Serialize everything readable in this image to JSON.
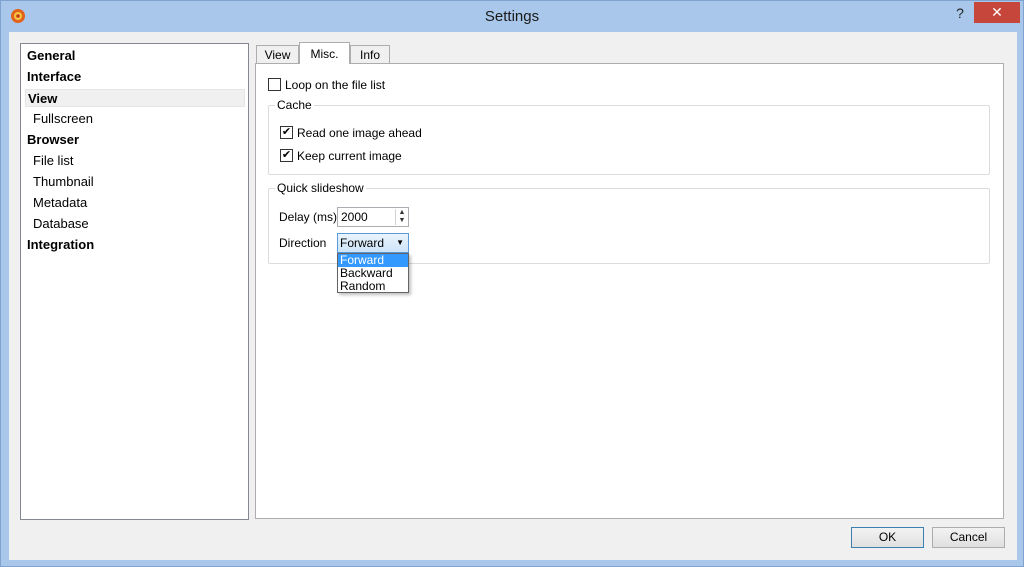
{
  "window": {
    "title": "Settings",
    "help_label": "?",
    "close_label": "✕"
  },
  "nav": {
    "items": [
      {
        "label": "General",
        "level": 0
      },
      {
        "label": "Interface",
        "level": 0
      },
      {
        "label": "View",
        "level": 0,
        "selected": true
      },
      {
        "label": "Fullscreen",
        "level": 1
      },
      {
        "label": "Browser",
        "level": 0
      },
      {
        "label": "File list",
        "level": 1
      },
      {
        "label": "Thumbnail",
        "level": 1
      },
      {
        "label": "Metadata",
        "level": 1
      },
      {
        "label": "Database",
        "level": 1
      },
      {
        "label": "Integration",
        "level": 0
      }
    ]
  },
  "tabs": [
    {
      "label": "View"
    },
    {
      "label": "Misc.",
      "active": true
    },
    {
      "label": "Info"
    }
  ],
  "misc": {
    "loop_label": "Loop on the file list",
    "loop_checked": false,
    "cache": {
      "title": "Cache",
      "read_ahead_label": "Read one image ahead",
      "read_ahead_checked": true,
      "keep_current_label": "Keep current image",
      "keep_current_checked": true
    },
    "slideshow": {
      "title": "Quick slideshow",
      "delay_label": "Delay (ms)",
      "delay_value": "2000",
      "direction_label": "Direction",
      "direction_value": "Forward",
      "direction_options": [
        "Forward",
        "Backward",
        "Random"
      ]
    }
  },
  "buttons": {
    "ok_label": "OK",
    "cancel_label": "Cancel"
  }
}
